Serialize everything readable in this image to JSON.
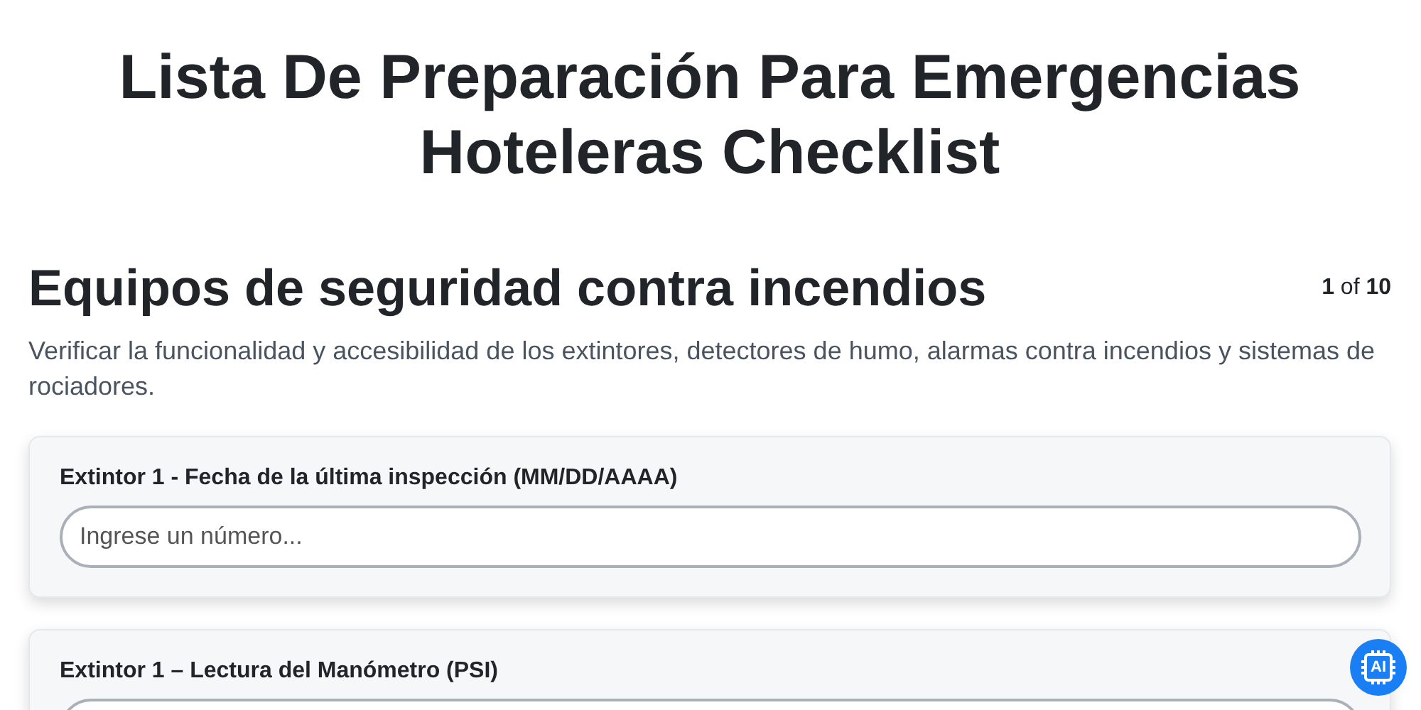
{
  "title": "Lista De Preparación Para Emergencias Hoteleras Checklist",
  "section": {
    "heading": "Equipos de seguridad contra incendios",
    "pager": "**1** of **10**",
    "description": "Verificar la funcionalidad y accesibilidad de los extintores, detectores de humo, alarmas contra incendios y sistemas de rociadores."
  },
  "questions": [
    {
      "label": "Extintor 1 - Fecha de la última inspección (MM/DD/AAAA)",
      "placeholder": "Ingrese un número..."
    },
    {
      "label": "Extintor 1 – Lectura del Manómetro (PSI)"
    }
  ],
  "assistant_button": {
    "label": "AI"
  }
}
